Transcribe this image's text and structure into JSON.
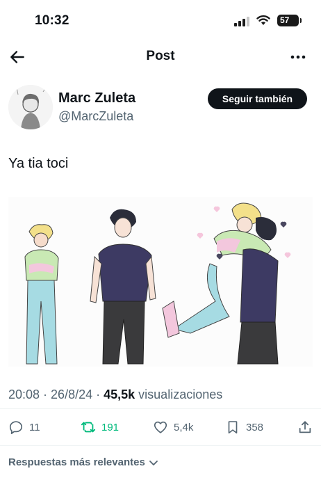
{
  "status_bar": {
    "time": "10:32",
    "battery": "57",
    "icons": [
      "signal-icon",
      "wifi-icon",
      "battery-icon"
    ]
  },
  "nav": {
    "title": "Post",
    "back_icon": "arrow-left-icon",
    "more_icon": "more-icon"
  },
  "author": {
    "name": "Marc Zuleta",
    "handle": "@MarcZuleta",
    "follow_label": "Seguir también"
  },
  "tweet": {
    "text": "Ya tia toci"
  },
  "meta": {
    "time": "20:08",
    "separator": " · ",
    "date": "26/8/24",
    "views_count": "45,5k",
    "views_label": "visualizaciones"
  },
  "actions": {
    "replies": "11",
    "retweets": "191",
    "likes": "5,4k",
    "bookmarks": "358"
  },
  "replies_sort": {
    "label": "Respuestas más relevantes"
  },
  "colors": {
    "retweet_active": "#00ba7c",
    "secondary_text": "#536471",
    "button_bg": "#0f1419"
  }
}
